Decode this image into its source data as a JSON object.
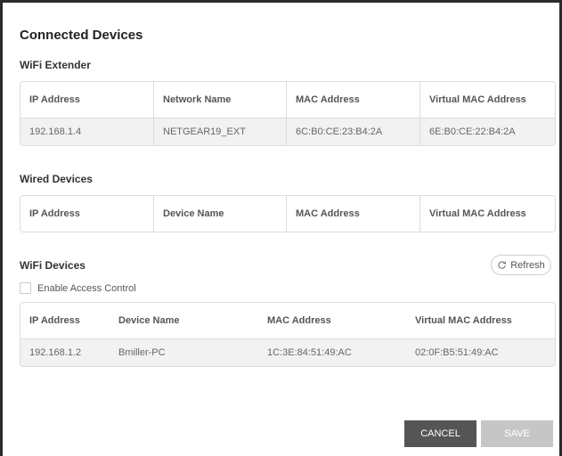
{
  "page": {
    "title": "Connected Devices"
  },
  "wifi_extender": {
    "heading": "WiFi Extender",
    "columns": [
      "IP Address",
      "Network Name",
      "MAC Address",
      "Virtual MAC Address"
    ],
    "rows": [
      [
        "192.168.1.4",
        "NETGEAR19_EXT",
        "6C:B0:CE:23:B4:2A",
        "6E:B0:CE:22:B4:2A"
      ]
    ]
  },
  "wired_devices": {
    "heading": "Wired Devices",
    "columns": [
      "IP Address",
      "Device Name",
      "MAC Address",
      "Virtual MAC Address"
    ],
    "rows": []
  },
  "wifi_devices": {
    "heading": "WiFi Devices",
    "refresh_label": "Refresh",
    "access_control_label": "Enable Access Control",
    "access_control_checked": false,
    "columns": [
      "IP Address",
      "Device Name",
      "MAC Address",
      "Virtual MAC Address"
    ],
    "rows": [
      [
        "192.168.1.2",
        "Bmiller-PC",
        "1C:3E:84:51:49:AC",
        "02:0F:B5:51:49:AC"
      ]
    ]
  },
  "actions": {
    "cancel_label": "CANCEL",
    "save_label": "SAVE"
  },
  "colors": {
    "cancel_button": "#555555",
    "save_button_disabled": "#c6c6c6",
    "row_background": "#f2f2f2"
  }
}
